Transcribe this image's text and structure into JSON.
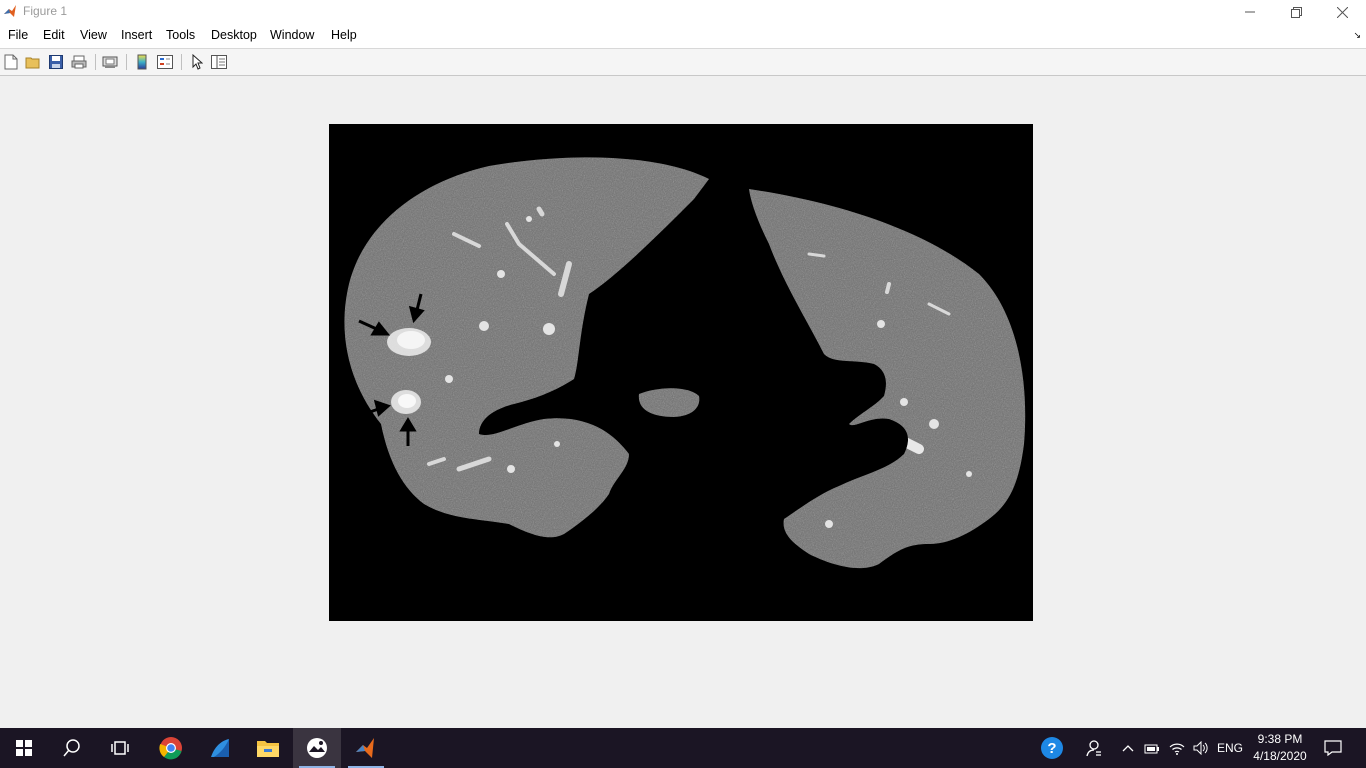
{
  "window": {
    "title": "Figure 1",
    "app_icon": "matlab-icon"
  },
  "menu": [
    "File",
    "Edit",
    "View",
    "Insert",
    "Tools",
    "Desktop",
    "Window",
    "Help"
  ],
  "toolbar": [
    "new-figure-icon",
    "open-file-icon",
    "save-icon",
    "print-icon",
    "link-plot-icon",
    "insert-colorbar-icon",
    "insert-legend-icon",
    "edit-plot-icon",
    "property-inspector-icon"
  ],
  "taskbar": {
    "apps": [
      "start-icon",
      "search-icon",
      "task-view-icon",
      "chrome-icon",
      "app-icon",
      "file-explorer-icon",
      "photos-icon",
      "matlab-icon"
    ],
    "tray_language": "ENG",
    "time": "9:38 PM",
    "date": "4/18/2020"
  },
  "colors": {
    "taskbar": "#1b1524",
    "figure_bg": "#f0f0f0",
    "axes_bg": "#000000"
  }
}
